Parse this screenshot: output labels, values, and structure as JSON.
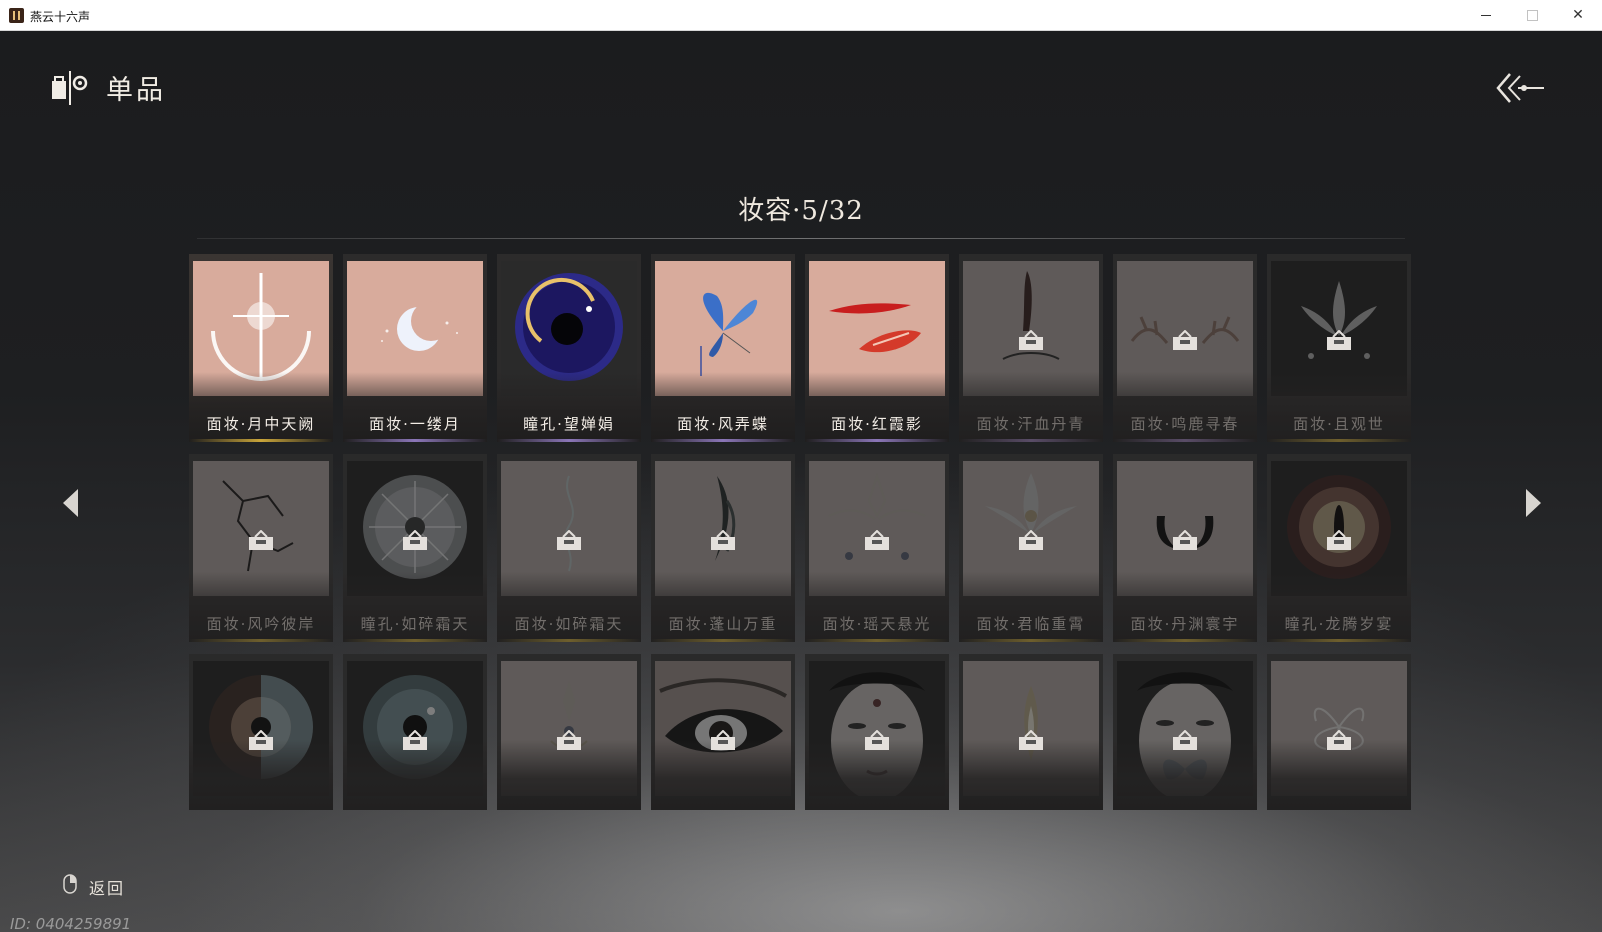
{
  "window": {
    "title": "燕云十六声",
    "minimize_glyph": "—",
    "maximize_glyph": "☐",
    "close_glyph": "✕"
  },
  "header": {
    "title": "单品",
    "logo_icon": "shop-bag-icon",
    "back_icon": "double-chevron-back-icon"
  },
  "section": {
    "title": "妆容·5/32"
  },
  "navigation": {
    "prev_icon": "triangle-left-icon",
    "next_icon": "triangle-right-icon"
  },
  "items": [
    {
      "label": "面妆·月中天阙",
      "locked": false,
      "selected": true,
      "art": "moon-cross",
      "underline": "#c9a53a"
    },
    {
      "label": "面妆·一缕月",
      "locked": false,
      "art": "crescent-moon",
      "underline": "#8b76b8"
    },
    {
      "label": "瞳孔·望婵娟",
      "locked": false,
      "art": "galaxy-eye",
      "underline": "#8b76b8"
    },
    {
      "label": "面妆·风弄蝶",
      "locked": false,
      "art": "butterfly",
      "underline": "#8b76b8"
    },
    {
      "label": "面妆·红霞影",
      "locked": false,
      "art": "red-strokes",
      "underline": "#8b76b8"
    },
    {
      "label": "面妆·汗血丹青",
      "locked": true,
      "art": "red-stroke-v",
      "underline": "#6d5b80"
    },
    {
      "label": "面妆·鸣鹿寻春",
      "locked": true,
      "art": "antlers",
      "underline": "#6d5b80"
    },
    {
      "label": "面妆·且观世",
      "locked": true,
      "art": "lotus-crown",
      "underline": "#8a7530"
    },
    {
      "label": "面妆·风吟彼岸",
      "locked": true,
      "art": "cracks",
      "underline": "#8a7530"
    },
    {
      "label": "瞳孔·如碎霜天",
      "locked": true,
      "art": "frost-eye",
      "underline": "#8a7530"
    },
    {
      "label": "面妆·如碎霜天",
      "locked": true,
      "art": "frost-swirl",
      "underline": "#8a7530"
    },
    {
      "label": "面妆·蓬山万重",
      "locked": true,
      "art": "mountain-stroke",
      "underline": "#8a7530"
    },
    {
      "label": "面妆·瑶天悬光",
      "locked": true,
      "art": "jewel-pattern",
      "underline": "#8a7530"
    },
    {
      "label": "面妆·君临重霄",
      "locked": true,
      "art": "crown-ornament",
      "underline": "#8a7530"
    },
    {
      "label": "面妆·丹渊寰宇",
      "locked": true,
      "art": "horns",
      "underline": "#8a7530"
    },
    {
      "label": "瞳孔·龙腾岁宴",
      "locked": true,
      "art": "dragon-eye",
      "underline": "#8a7530"
    },
    {
      "label": "",
      "locked": true,
      "art": "split-eye",
      "underline": ""
    },
    {
      "label": "",
      "locked": true,
      "art": "teal-eye",
      "underline": ""
    },
    {
      "label": "",
      "locked": true,
      "art": "gold-drop",
      "underline": ""
    },
    {
      "label": "",
      "locked": true,
      "art": "smoky-eye",
      "underline": ""
    },
    {
      "label": "",
      "locked": true,
      "art": "face-dot",
      "underline": ""
    },
    {
      "label": "",
      "locked": true,
      "art": "gold-flame",
      "underline": ""
    },
    {
      "label": "",
      "locked": true,
      "art": "face-butterfly",
      "underline": ""
    },
    {
      "label": "",
      "locked": true,
      "art": "chrysanthemum",
      "underline": ""
    }
  ],
  "footer": {
    "back_label": "返回",
    "mouse_icon": "mouse-right-click-icon",
    "player_id": "ID: 0404259891"
  }
}
